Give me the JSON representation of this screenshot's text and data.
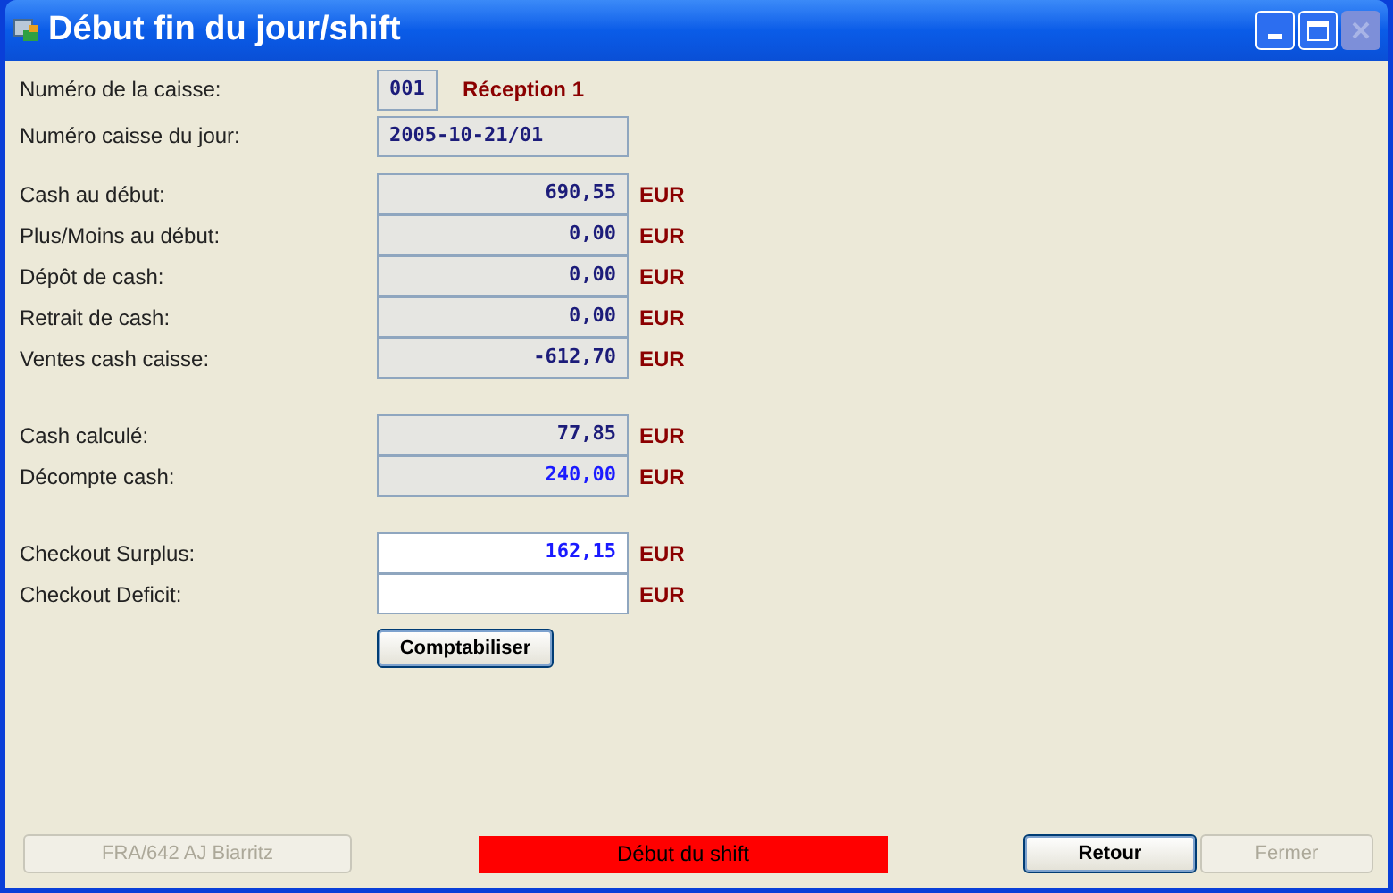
{
  "window": {
    "title": "Début fin du jour/shift",
    "close_disabled": true
  },
  "header_rows": [
    {
      "label": "Numéro de la caisse:",
      "value": "001",
      "note": "Réception 1"
    },
    {
      "label": "Numéro caisse du jour:",
      "value": "2005-10-21/01"
    }
  ],
  "groups": [
    [
      {
        "label": "Cash au début:",
        "value": "690,55",
        "unit": "EUR",
        "kind": "readonly"
      },
      {
        "label": "Plus/Moins au début:",
        "value": "0,00",
        "unit": "EUR",
        "kind": "readonly"
      },
      {
        "label": "Dépôt de cash:",
        "value": "0,00",
        "unit": "EUR",
        "kind": "readonly"
      },
      {
        "label": "Retrait de cash:",
        "value": "0,00",
        "unit": "EUR",
        "kind": "readonly"
      },
      {
        "label": "Ventes cash caisse:",
        "value": "-612,70",
        "unit": "EUR",
        "kind": "readonly"
      }
    ],
    [
      {
        "label": "Cash calculé:",
        "value": "77,85",
        "unit": "EUR",
        "kind": "readonly"
      },
      {
        "label": "Décompte cash:",
        "value": "240,00",
        "unit": "EUR",
        "kind": "counted"
      }
    ],
    [
      {
        "label": "Checkout Surplus:",
        "value": "162,15",
        "unit": "EUR",
        "kind": "result"
      },
      {
        "label": "Checkout Deficit:",
        "unit": "EUR",
        "kind": "result"
      }
    ]
  ],
  "post_button": {
    "label": "Comptabiliser"
  },
  "footer": {
    "location": {
      "label": "FRA/642 AJ Biarritz",
      "disabled": true
    },
    "status": "Début du shift",
    "buttons": [
      {
        "label": "Retour",
        "disabled": false
      },
      {
        "label": "Fermer",
        "disabled": true
      }
    ]
  }
}
